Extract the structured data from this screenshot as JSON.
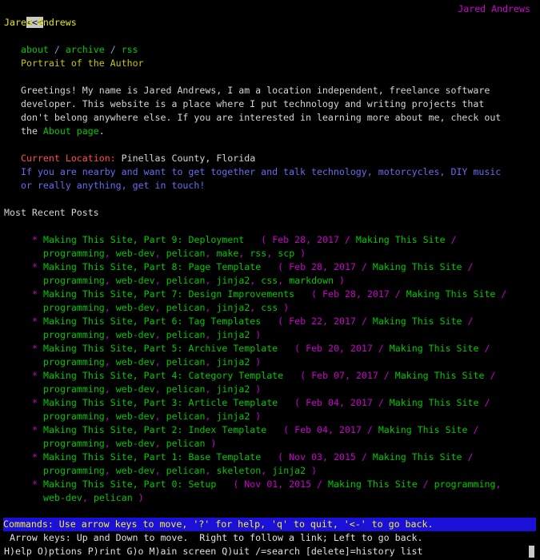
{
  "header": {
    "back_label": "<<<",
    "page_title": "Jared Andrews"
  },
  "site": {
    "name": "Jared Andrews"
  },
  "nav": {
    "items": [
      "about",
      "archive",
      "rss"
    ],
    "separator": "/"
  },
  "portrait_alt": "Portrait of the Author",
  "intro": {
    "text": "Greetings! My name is Jared Andrews, I am a location independent, freelance software developer. This website is a place where I put technology and writing projects that don't belong anywhere else. If you are interested in learning more about me, check out the ",
    "link": "About page",
    "end": "."
  },
  "location": {
    "label": "Current Location:",
    "value": "Pinellas County, Florida",
    "contact": "If you are nearby and want to get together and talk technology, motorcycles, DIY music or really anything, get in touch!"
  },
  "recent": {
    "heading": "Most Recent Posts"
  },
  "posts": [
    {
      "title": "Making This Site, Part 9: Deployment",
      "date": "Feb 28, 2017",
      "category": "Making This Site",
      "tags": [
        "programming",
        "web-dev",
        "pelican",
        "make",
        "rss",
        "scp"
      ]
    },
    {
      "title": "Making This Site, Part 8: Page Template",
      "date": "Feb 28, 2017",
      "category": "Making This Site",
      "tags": [
        "programming",
        "web-dev",
        "pelican",
        "jinja2",
        "css",
        "markdown"
      ]
    },
    {
      "title": "Making This Site, Part 7: Design Improvements",
      "date": "Feb 28, 2017",
      "category": "Making This Site",
      "tags": [
        "programming",
        "web-dev",
        "pelican",
        "jinja2",
        "css"
      ]
    },
    {
      "title": "Making This Site, Part 6: Tag Templates",
      "date": "Feb 22, 2017",
      "category": "Making This Site",
      "tags": [
        "programming",
        "web-dev",
        "pelican",
        "jinja2"
      ]
    },
    {
      "title": "Making This Site, Part 5: Archive Template",
      "date": "Feb 20, 2017",
      "category": "Making This Site",
      "tags": [
        "programming",
        "web-dev",
        "pelican",
        "jinja2"
      ]
    },
    {
      "title": "Making This Site, Part 4: Category Template",
      "date": "Feb 07, 2017",
      "category": "Making This Site",
      "tags": [
        "programming",
        "web-dev",
        "pelican",
        "jinja2"
      ]
    },
    {
      "title": "Making This Site, Part 3: Article Template",
      "date": "Feb 04, 2017",
      "category": "Making This Site",
      "tags": [
        "programming",
        "web-dev",
        "pelican",
        "jinja2"
      ]
    },
    {
      "title": "Making This Site, Part 2: Index Template",
      "date": "Feb 04, 2017",
      "category": "Making This Site",
      "tags": [
        "programming",
        "web-dev",
        "pelican"
      ]
    },
    {
      "title": "Making This Site, Part 1: Base Template",
      "date": "Nov 03, 2015",
      "category": "Making This Site",
      "tags": [
        "programming",
        "web-dev",
        "pelican",
        "skeleton",
        "jinja2"
      ]
    },
    {
      "title": "Making This Site, Part 0: Setup",
      "date": "Nov 01, 2015",
      "category": "Making This Site",
      "tags": [
        "programming",
        "web-dev",
        "pelican"
      ]
    }
  ],
  "statusbar": {
    "commands": "Commands: Use arrow keys to move, '?' for help, 'q' to quit, '<-' to go back.",
    "arrow_help": " Arrow keys: Up and Down to move.  Right to follow a link; Left to go back.",
    "key_help": "H)elp O)ptions P)rint G)o M)ain screen Q)uit /=search [delete]=history list"
  },
  "colors": {
    "link": "#00c800",
    "meta": "#c800c8",
    "status_bg": "#1a10d8",
    "status_fg": "#f0f040"
  }
}
